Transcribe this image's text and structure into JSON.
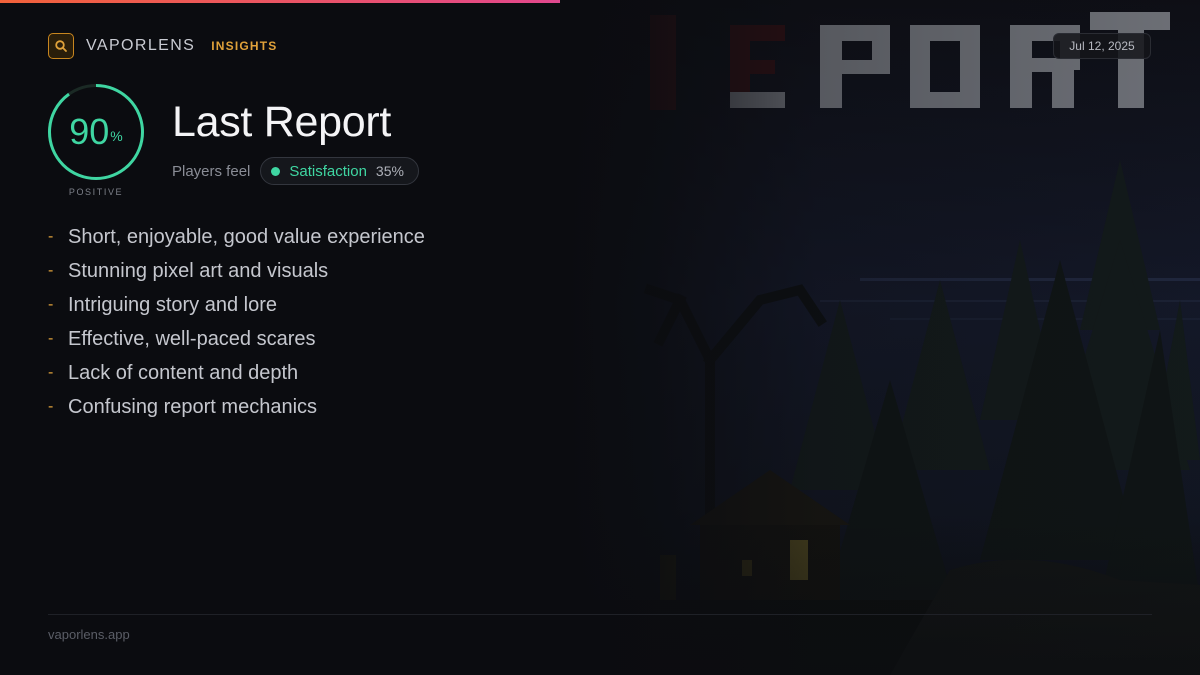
{
  "header": {
    "brand_name": "VAPORLENS",
    "section": "INSIGHTS",
    "date": "Jul 12, 2025"
  },
  "score": {
    "value": "90",
    "unit": "%",
    "percent": 90,
    "label": "POSITIVE",
    "color": "#3fd6a2"
  },
  "game": {
    "title": "Last Report"
  },
  "sentiment": {
    "label": "Players feel",
    "name": "Satisfaction",
    "percent": "35%"
  },
  "highlights": [
    "Short, enjoyable, good value experience",
    "Stunning pixel art and visuals",
    "Intriguing story and lore",
    "Effective, well-paced scares",
    "Lack of content and depth",
    "Confusing report mechanics"
  ],
  "footer": {
    "url": "vaporlens.app"
  },
  "colors": {
    "accent": "#e0a23a",
    "positive": "#3fd6a2",
    "background": "#0b0c10"
  },
  "icons": {
    "brand": "search-icon"
  }
}
